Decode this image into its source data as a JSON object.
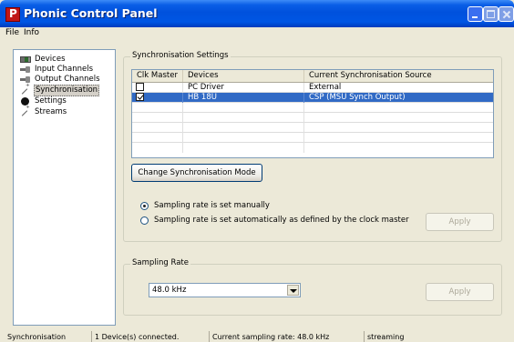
{
  "window": {
    "title": "Phonic Control Panel"
  },
  "menu": [
    "File",
    "Info"
  ],
  "tree": [
    {
      "label": "Devices",
      "icon": "devices-icon"
    },
    {
      "label": "Input Channels",
      "icon": "input-channels-icon"
    },
    {
      "label": "Output Channels",
      "icon": "output-channels-icon"
    },
    {
      "label": "Synchronisation",
      "icon": "synchronisation-icon",
      "selected": true
    },
    {
      "label": "Settings",
      "icon": "settings-icon"
    },
    {
      "label": "Streams",
      "icon": "streams-icon"
    }
  ],
  "sync": {
    "group_title": "Synchronisation Settings",
    "columns": [
      "Clk Master",
      "Devices",
      "Current Synchronisation Source"
    ],
    "rows": [
      {
        "master": false,
        "device": "PC Driver",
        "source": "External"
      },
      {
        "master": true,
        "device": "HB 18U",
        "source": "CSP (MSU Synch Output)",
        "selected": true
      }
    ],
    "change_button": "Change Synchronisation Mode",
    "radio_manual": "Sampling rate is set manually",
    "radio_auto": "Sampling rate is set automatically as defined by the clock master",
    "selected_mode": "manual",
    "apply": "Apply"
  },
  "sampling": {
    "group_title": "Sampling Rate",
    "value": "48.0 kHz",
    "apply": "Apply"
  },
  "status": {
    "page": "Synchronisation",
    "devices": "1 Device(s) connected.",
    "rate": "Current sampling rate: 48.0 kHz",
    "state": "streaming"
  },
  "colors": {
    "title_bar": "#0a5ee6",
    "selection": "#316ac5",
    "window_bg": "#ece9d8"
  }
}
